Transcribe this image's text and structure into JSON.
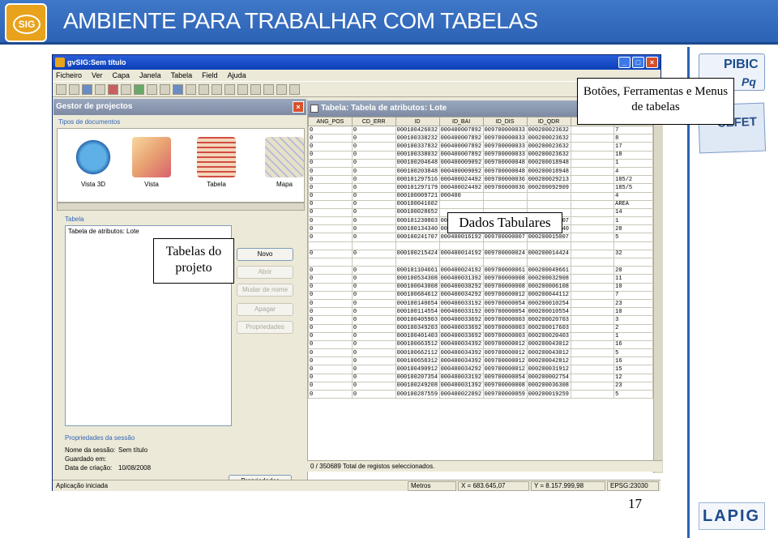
{
  "slide": {
    "title": "AMBIENTE PARA TRABALHAR COM TABELAS",
    "logo_text": "SIG",
    "page_number": "17",
    "logos": {
      "pibic": "PIBIC",
      "pibic_sub": "Pq",
      "cefet": "CEFET",
      "lapig": "LAPIG"
    }
  },
  "callouts": {
    "tools": "Botões, Ferramentas e Menus de tabelas",
    "data": "Dados Tabulares",
    "project_tables": "Tabelas do projeto"
  },
  "app": {
    "title": "gvSIG:Sem título",
    "menu": [
      "Ficheiro",
      "Ver",
      "Capa",
      "Janela",
      "Tabela",
      "Field",
      "Ajuda"
    ]
  },
  "project_manager": {
    "title": "Gestor de projectos",
    "doc_types_label": "Tipos de documentos",
    "doc_types": [
      {
        "label": "Vista 3D",
        "icon": "globe-icon"
      },
      {
        "label": "Vista",
        "icon": "layers-icon"
      },
      {
        "label": "Tabela",
        "icon": "table-icon"
      },
      {
        "label": "Mapa",
        "icon": "map-icon"
      }
    ],
    "tabela_label": "Tabela",
    "tables": [
      "Tabela de atributos: Lote"
    ],
    "buttons": [
      "Novo",
      "Abrir",
      "Mudar de nome",
      "Apagar",
      "Propriedades"
    ],
    "session_label": "Propriedades da sessão",
    "session": [
      {
        "k": "Nome da sessão:",
        "v": "Sem título"
      },
      {
        "k": "Guardado em:",
        "v": ""
      },
      {
        "k": "Data de criação:",
        "v": "10/08/2008"
      }
    ],
    "properties_button": "Propriedades"
  },
  "table_window": {
    "title": "Tabela: Tabela de atributos: Lote",
    "columns": [
      "ANG_POS",
      "CD_ERR",
      "ID",
      "ID_BAI",
      "ID_DIS",
      "ID_QDR",
      "",
      ""
    ],
    "rows": [
      [
        "0",
        "0",
        "000100426032",
        "000400007892",
        "009700000033",
        "000200023632",
        "",
        "7"
      ],
      [
        "0",
        "0",
        "000100338232",
        "000400007892",
        "009700000033",
        "000200023632",
        "",
        "8"
      ],
      [
        "0",
        "0",
        "000100337832",
        "000400007892",
        "009700000033",
        "000200023632",
        "",
        "17"
      ],
      [
        "0",
        "0",
        "000100338032",
        "000400007892",
        "009700000033",
        "000200023632",
        "",
        "18"
      ],
      [
        "0",
        "0",
        "000100204648",
        "000400009092",
        "009700000048",
        "000200018948",
        "",
        "1"
      ],
      [
        "0",
        "0",
        "000100203848",
        "000400009092",
        "009700000048",
        "000200018948",
        "",
        "4"
      ],
      [
        "0",
        "0",
        "000101297516",
        "000400024492",
        "009700000036",
        "000200029213",
        "",
        "185/2"
      ],
      [
        "0",
        "0",
        "000101297179",
        "000400024492",
        "009700000036",
        "000200092909",
        "",
        "185/5"
      ],
      [
        "0",
        "0",
        "000100009721",
        "000400",
        "",
        "",
        "",
        "4"
      ],
      [
        "0",
        "0",
        "000100041602",
        "",
        "",
        "",
        "",
        "AREA"
      ],
      [
        "0",
        "0",
        "000100028652",
        "",
        "",
        "",
        "",
        "14"
      ],
      [
        "0",
        "0",
        "000101230803",
        "000400016192",
        "009700000007",
        "000200022607",
        "",
        "1"
      ],
      [
        "0",
        "0",
        "000100134340",
        "000400006292",
        "009700000040",
        "000200029140",
        "",
        "28"
      ],
      [
        "0",
        "0",
        "000100241707",
        "000400016192",
        "009700000007",
        "000200015007",
        "",
        "5"
      ],
      [
        "",
        "",
        "",
        "",
        "",
        "",
        "",
        ""
      ],
      [
        "0",
        "0",
        "000100215424",
        "000400014192",
        "009700000024",
        "000200014424",
        "",
        "32"
      ],
      [
        "",
        "",
        "",
        "",
        "",
        "",
        "",
        ""
      ],
      [
        "0",
        "0",
        "000101104661",
        "000400024192",
        "009700000061",
        "000200049661",
        "",
        "20"
      ],
      [
        "0",
        "0",
        "000100534308",
        "000400031392",
        "009700000008",
        "000200032908",
        "",
        "11"
      ],
      [
        "0",
        "0",
        "000100043008",
        "000400030292",
        "009700000008",
        "000200006108",
        "",
        "10"
      ],
      [
        "0",
        "0",
        "000100684612",
        "000400034292",
        "009700000012",
        "000200044112",
        "",
        "7"
      ],
      [
        "0",
        "0",
        "000100140654",
        "000400033192",
        "009700000054",
        "000200010254",
        "",
        "23"
      ],
      [
        "0",
        "0",
        "000100114554",
        "000400033192",
        "009700000054",
        "000200010554",
        "",
        "10"
      ],
      [
        "0",
        "0",
        "000100405903",
        "000400033692",
        "009700000003",
        "000200020703",
        "",
        "3"
      ],
      [
        "0",
        "0",
        "000100349203",
        "000400033692",
        "009700000003",
        "000200017603",
        "",
        "2"
      ],
      [
        "0",
        "0",
        "000100401403",
        "000400033692",
        "009700000003",
        "000200020403",
        "",
        "1"
      ],
      [
        "0",
        "0",
        "000100663512",
        "000400034392",
        "009700000012",
        "000200043012",
        "",
        "16"
      ],
      [
        "0",
        "0",
        "000100662112",
        "000400034392",
        "009700000012",
        "000200043012",
        "",
        "5"
      ],
      [
        "0",
        "0",
        "000100658312",
        "000400034392",
        "009700000012",
        "000200042812",
        "",
        "16"
      ],
      [
        "0",
        "0",
        "000100490912",
        "000400034292",
        "009700000012",
        "000200031912",
        "",
        "15"
      ],
      [
        "0",
        "0",
        "000100207354",
        "000400033192",
        "009700000054",
        "000200002754",
        "",
        "12"
      ],
      [
        "0",
        "0",
        "000100249208",
        "000400031392",
        "009700000008",
        "000200036308",
        "",
        "23"
      ],
      [
        "0",
        "0",
        "000100287559",
        "000400022092",
        "009700000059",
        "000200019259",
        "",
        "5"
      ]
    ],
    "selection_status": "0 / 350689 Total de registos seleccionados."
  },
  "statusbar": {
    "left": "Aplicação iniciada",
    "units": "Metros",
    "x": "X = 683.645,07",
    "y": "Y = 8.157.999,98",
    "epsg": "EPSG:23030"
  }
}
